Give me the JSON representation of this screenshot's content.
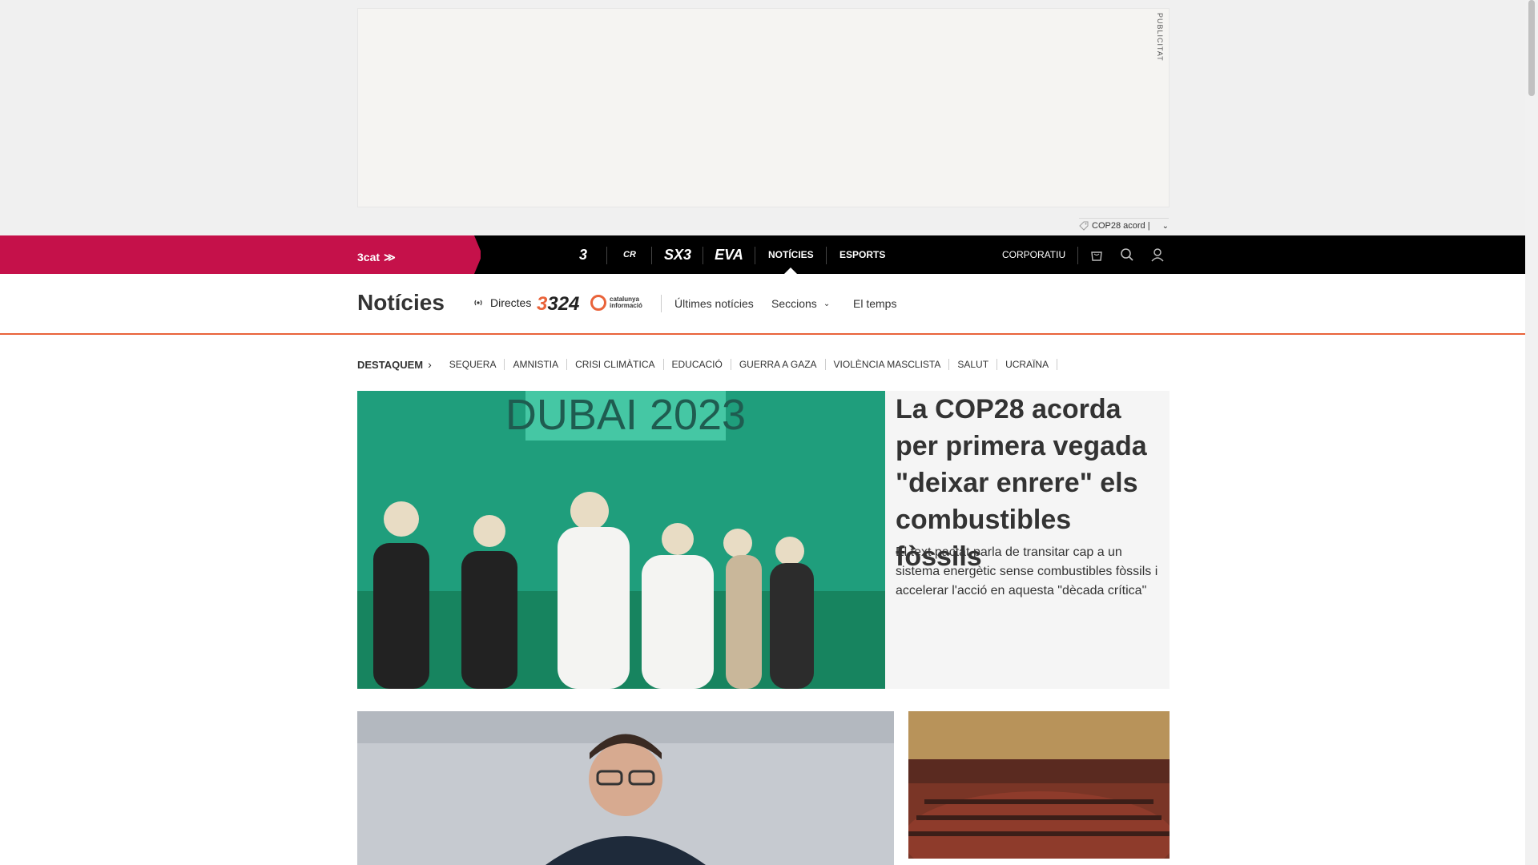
{
  "ad": {
    "label": "PUBLICITAT",
    "tag": "COP28 acord |"
  },
  "topnav": {
    "brand": "3cat",
    "channels": [
      "3",
      "CR",
      "SX3",
      "EVA"
    ],
    "links": [
      "NOTÍCIES",
      "ESPORTS"
    ],
    "active": "NOTÍCIES",
    "corporate": "CORPORATIU"
  },
  "section": {
    "title": "Notícies",
    "directes": "Directes",
    "logo_324": "324",
    "catinfo": "catalunya informació",
    "links": [
      "Últimes notícies",
      "Seccions",
      "El temps"
    ]
  },
  "tags": {
    "lead": "DESTAQUEM",
    "items": [
      "SEQUERA",
      "AMNISTIA",
      "CRISI CLIMÀTICA",
      "EDUCACIÓ",
      "GUERRA A GAZA",
      "VIOLÈNCIA MASCLISTA",
      "SALUT",
      "UCRAÏNA"
    ]
  },
  "hero": {
    "image_text": "DUBAI 2023",
    "title": "La COP28 acorda per primera vegada \"deixar enrere\" els combustibles fòssils",
    "subtitle": "El text pactat parla de transitar cap a un sistema energètic sense combustibles fòssils i accelerar l'acció en aquesta \"dècada crítica\""
  },
  "colors": {
    "brand": "#c5114a",
    "accent": "#e9633a",
    "nav_bg": "#000000"
  }
}
